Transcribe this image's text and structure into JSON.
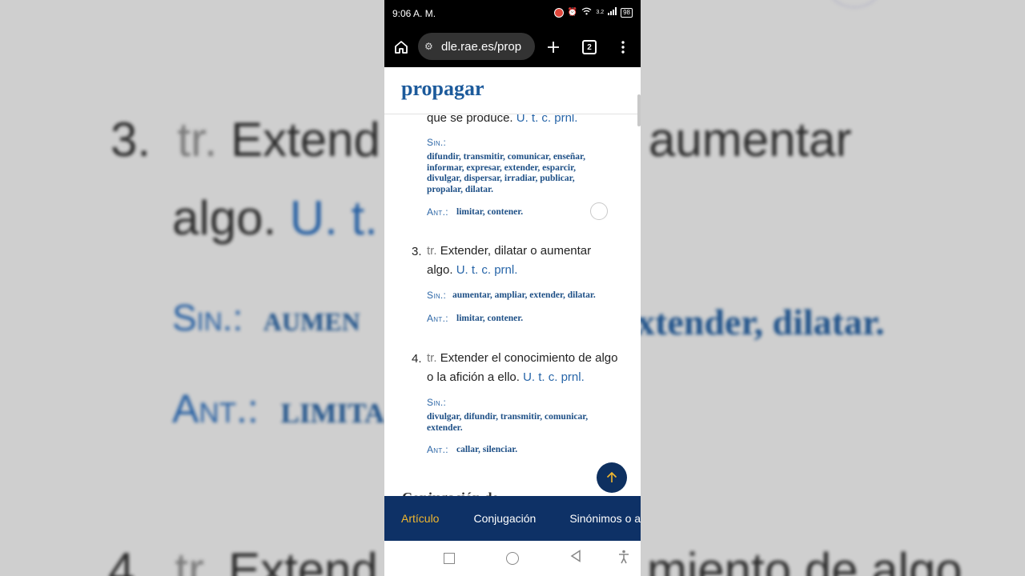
{
  "background_zoom": {
    "line1_pos": "3.",
    "line1_abbr": "tr.",
    "line1_text": "Extend",
    "line1_right": "aumentar",
    "line2_text": "algo.",
    "line2_tail": "U. t.",
    "line3_label": "Sin.:",
    "line3_text": "aumen",
    "line3_right": "xtender, dilatar.",
    "line4_label": "Ant.:",
    "line4_text": "limita",
    "line5_pos": "4.",
    "line5_abbr": "tr.",
    "line5_text": "Extend",
    "line5_right": "miento de algo"
  },
  "status_bar": {
    "time": "9:06 A. M.",
    "battery": "98",
    "net": "3.2"
  },
  "browser": {
    "url": "dle.rae.es/prop",
    "tab_count": "2"
  },
  "page": {
    "headword": "propagar",
    "partial_line_text": "que se produce.",
    "partial_line_note": "U. t. c. prnl.",
    "block2": {
      "sin_label": "Sin.:",
      "sin_lines": [
        "difundir, transmitir, comunicar, enseñar,",
        "informar, expresar, extender, esparcir,",
        "divulgar, dispersar, irradiar, publicar,",
        "propalar, dilatar."
      ],
      "ant_label": "Ant.:",
      "ant_text": "limitar, contener."
    },
    "def3": {
      "num": "3.",
      "abbr": "tr.",
      "text1": "Extender, dilatar o aumentar",
      "text2": "algo.",
      "note": "U. t. c. prnl.",
      "sin_label": "Sin.:",
      "sin_text": "aumentar, ampliar, extender, dilatar.",
      "ant_label": "Ant.:",
      "ant_text": "limitar, contener."
    },
    "def4": {
      "num": "4.",
      "abbr": "tr.",
      "text1": "Extender el conocimiento de algo",
      "text2": "o la afición a ello.",
      "note": "U. t. c. prnl.",
      "sin_label": "Sin.:",
      "sin_lines": [
        "divulgar, difundir, transmitir, comunicar,",
        "extender."
      ],
      "ant_label": "Ant.:",
      "ant_text": "callar, silenciar."
    },
    "next_heading": "Conjugación de"
  },
  "bottom_nav": {
    "tab1": "Artículo",
    "tab2": "Conjugación",
    "tab3": "Sinónimos o antónimos"
  },
  "icons": {
    "home": "home-icon",
    "new_tab": "plus-icon",
    "menu": "kebab-icon",
    "scroll_top": "arrow-up-icon"
  },
  "colors": {
    "accent": "#1c5a9b",
    "nav_bg": "#0e3166",
    "nav_active": "#f1b72e"
  }
}
